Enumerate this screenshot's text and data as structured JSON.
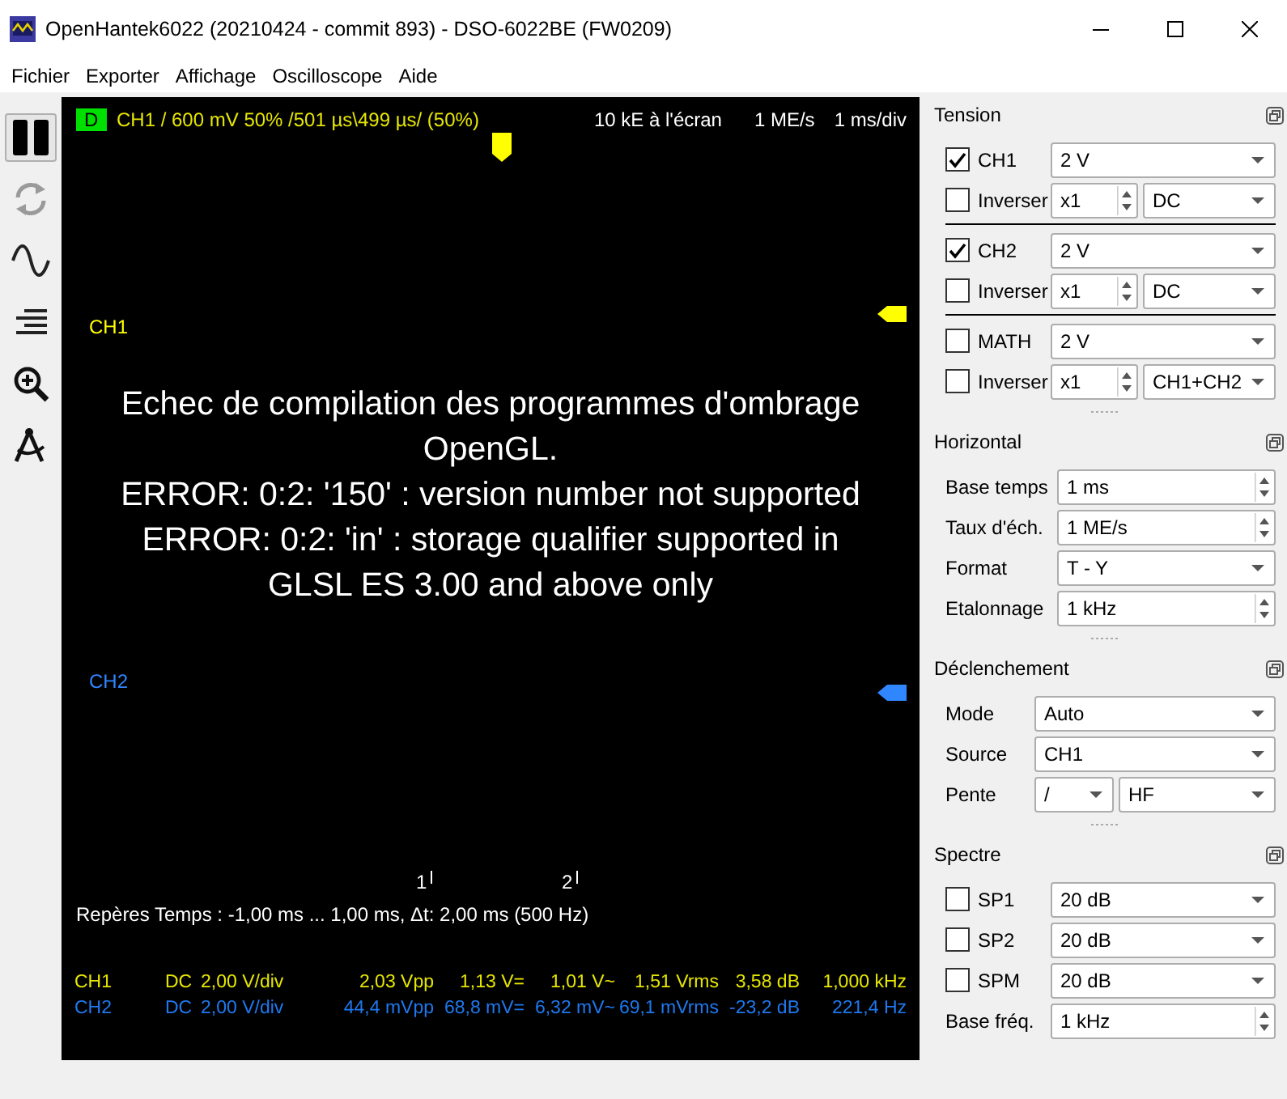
{
  "window": {
    "title": "OpenHantek6022 (20210424 - commit 893) - DSO-6022BE (FW0209)"
  },
  "menu": [
    "Fichier",
    "Exporter",
    "Affichage",
    "Oscilloscope",
    "Aide"
  ],
  "toolbar": [
    {
      "kind": "pause",
      "selected": true,
      "disabled": false
    },
    {
      "kind": "refresh",
      "selected": false,
      "disabled": true
    },
    {
      "kind": "wave",
      "selected": false,
      "disabled": false
    },
    {
      "kind": "lines",
      "selected": false,
      "disabled": false
    },
    {
      "kind": "zoom",
      "selected": false,
      "disabled": false
    },
    {
      "kind": "measure",
      "selected": false,
      "disabled": false
    }
  ],
  "scope": {
    "header": {
      "mode": "D",
      "trigger": "CH1  /  600 mV  50%  /501 µs\\499 µs/ (50%)",
      "record": "10 kE  à l'écran",
      "rate": "1 ME/s",
      "timebase": "1 ms/div"
    },
    "channel_labels": [
      {
        "label": "CH1",
        "color": "#ffff00"
      },
      {
        "label": "CH2",
        "color": "#2f86ff"
      }
    ],
    "message": "Echec de compilation des programmes d'ombrage OpenGL.\nERROR: 0:2: '150' : version number not supported\nERROR: 0:2: 'in' : storage qualifier supported in GLSL ES 3.00 and above only",
    "cursor_markers": [
      "1",
      "2"
    ],
    "markers_info": "Repères  Temps : -1,00 ms ... 1,00 ms,  Δt: 2,00 ms (500 Hz)",
    "measurements": [
      {
        "channel": "CH1",
        "coupling": "DC",
        "scale": "2,00 V/div",
        "vpp": "2,03 Vpp",
        "dc": "1,13 V=",
        "ac": "1,01 V~",
        "rms": "1,51 Vrms",
        "db": "3,58 dB",
        "freq": "1,000 kHz",
        "color": "#e6e600"
      },
      {
        "channel": "CH2",
        "coupling": "DC",
        "scale": "2,00 V/div",
        "vpp": "44,4 mVpp",
        "dc": "68,8 mV=",
        "ac": "6,32 mV~",
        "rms": "69,1 mVrms",
        "db": "-23,2 dB",
        "freq": "221,4 Hz",
        "color": "#1e78f0"
      }
    ]
  },
  "panel": [
    {
      "title": "Tension",
      "rows": [
        {
          "kind": "channel",
          "label": "CH1",
          "checked": true,
          "value": "2 V"
        },
        {
          "kind": "invert",
          "label": "Inverser",
          "checked": false,
          "spin": "x1",
          "value": "DC"
        },
        {
          "kind": "rule"
        },
        {
          "kind": "channel",
          "label": "CH2",
          "checked": true,
          "value": "2 V"
        },
        {
          "kind": "invert",
          "label": "Inverser",
          "checked": false,
          "spin": "x1",
          "value": "DC"
        },
        {
          "kind": "rule"
        },
        {
          "kind": "channel",
          "label": "MATH",
          "checked": false,
          "value": "2 V"
        },
        {
          "kind": "invert",
          "label": "Inverser",
          "checked": false,
          "spin": "x1",
          "value": "CH1+CH2"
        }
      ]
    },
    {
      "title": "Horizontal",
      "rows": [
        {
          "kind": "spin",
          "label": "Base temps",
          "value": "1 ms"
        },
        {
          "kind": "spin",
          "label": "Taux d'éch.",
          "value": "1 ME/s"
        },
        {
          "kind": "combo",
          "label": "Format",
          "value": "T - Y"
        },
        {
          "kind": "spin",
          "label": "Etalonnage",
          "value": "1 kHz"
        }
      ]
    },
    {
      "title": "Déclenchement",
      "rows": [
        {
          "kind": "combo",
          "label": "Mode",
          "value": "Auto"
        },
        {
          "kind": "combo",
          "label": "Source",
          "value": "CH1"
        },
        {
          "kind": "pair",
          "label": "Pente",
          "values": [
            "/",
            "HF"
          ]
        }
      ]
    },
    {
      "title": "Spectre",
      "rows": [
        {
          "kind": "channel",
          "label": "SP1",
          "checked": false,
          "value": "20 dB"
        },
        {
          "kind": "channel",
          "label": "SP2",
          "checked": false,
          "value": "20 dB"
        },
        {
          "kind": "channel",
          "label": "SPM",
          "checked": false,
          "value": "20 dB"
        },
        {
          "kind": "spin",
          "label": "Base fréq.",
          "value": "1 kHz"
        }
      ]
    }
  ]
}
